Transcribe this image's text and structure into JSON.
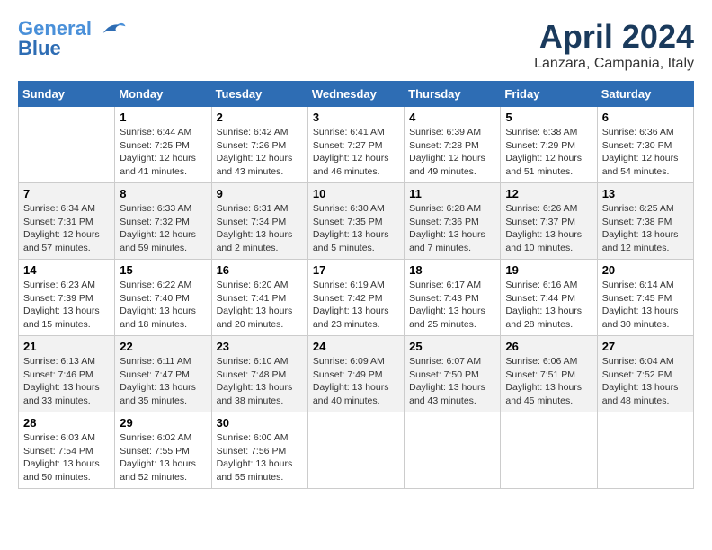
{
  "header": {
    "logo_line1": "General",
    "logo_line2": "Blue",
    "month": "April 2024",
    "location": "Lanzara, Campania, Italy"
  },
  "weekdays": [
    "Sunday",
    "Monday",
    "Tuesday",
    "Wednesday",
    "Thursday",
    "Friday",
    "Saturday"
  ],
  "weeks": [
    [
      {
        "day": "",
        "sunrise": "",
        "sunset": "",
        "daylight": ""
      },
      {
        "day": "1",
        "sunrise": "Sunrise: 6:44 AM",
        "sunset": "Sunset: 7:25 PM",
        "daylight": "Daylight: 12 hours and 41 minutes."
      },
      {
        "day": "2",
        "sunrise": "Sunrise: 6:42 AM",
        "sunset": "Sunset: 7:26 PM",
        "daylight": "Daylight: 12 hours and 43 minutes."
      },
      {
        "day": "3",
        "sunrise": "Sunrise: 6:41 AM",
        "sunset": "Sunset: 7:27 PM",
        "daylight": "Daylight: 12 hours and 46 minutes."
      },
      {
        "day": "4",
        "sunrise": "Sunrise: 6:39 AM",
        "sunset": "Sunset: 7:28 PM",
        "daylight": "Daylight: 12 hours and 49 minutes."
      },
      {
        "day": "5",
        "sunrise": "Sunrise: 6:38 AM",
        "sunset": "Sunset: 7:29 PM",
        "daylight": "Daylight: 12 hours and 51 minutes."
      },
      {
        "day": "6",
        "sunrise": "Sunrise: 6:36 AM",
        "sunset": "Sunset: 7:30 PM",
        "daylight": "Daylight: 12 hours and 54 minutes."
      }
    ],
    [
      {
        "day": "7",
        "sunrise": "Sunrise: 6:34 AM",
        "sunset": "Sunset: 7:31 PM",
        "daylight": "Daylight: 12 hours and 57 minutes."
      },
      {
        "day": "8",
        "sunrise": "Sunrise: 6:33 AM",
        "sunset": "Sunset: 7:32 PM",
        "daylight": "Daylight: 12 hours and 59 minutes."
      },
      {
        "day": "9",
        "sunrise": "Sunrise: 6:31 AM",
        "sunset": "Sunset: 7:34 PM",
        "daylight": "Daylight: 13 hours and 2 minutes."
      },
      {
        "day": "10",
        "sunrise": "Sunrise: 6:30 AM",
        "sunset": "Sunset: 7:35 PM",
        "daylight": "Daylight: 13 hours and 5 minutes."
      },
      {
        "day": "11",
        "sunrise": "Sunrise: 6:28 AM",
        "sunset": "Sunset: 7:36 PM",
        "daylight": "Daylight: 13 hours and 7 minutes."
      },
      {
        "day": "12",
        "sunrise": "Sunrise: 6:26 AM",
        "sunset": "Sunset: 7:37 PM",
        "daylight": "Daylight: 13 hours and 10 minutes."
      },
      {
        "day": "13",
        "sunrise": "Sunrise: 6:25 AM",
        "sunset": "Sunset: 7:38 PM",
        "daylight": "Daylight: 13 hours and 12 minutes."
      }
    ],
    [
      {
        "day": "14",
        "sunrise": "Sunrise: 6:23 AM",
        "sunset": "Sunset: 7:39 PM",
        "daylight": "Daylight: 13 hours and 15 minutes."
      },
      {
        "day": "15",
        "sunrise": "Sunrise: 6:22 AM",
        "sunset": "Sunset: 7:40 PM",
        "daylight": "Daylight: 13 hours and 18 minutes."
      },
      {
        "day": "16",
        "sunrise": "Sunrise: 6:20 AM",
        "sunset": "Sunset: 7:41 PM",
        "daylight": "Daylight: 13 hours and 20 minutes."
      },
      {
        "day": "17",
        "sunrise": "Sunrise: 6:19 AM",
        "sunset": "Sunset: 7:42 PM",
        "daylight": "Daylight: 13 hours and 23 minutes."
      },
      {
        "day": "18",
        "sunrise": "Sunrise: 6:17 AM",
        "sunset": "Sunset: 7:43 PM",
        "daylight": "Daylight: 13 hours and 25 minutes."
      },
      {
        "day": "19",
        "sunrise": "Sunrise: 6:16 AM",
        "sunset": "Sunset: 7:44 PM",
        "daylight": "Daylight: 13 hours and 28 minutes."
      },
      {
        "day": "20",
        "sunrise": "Sunrise: 6:14 AM",
        "sunset": "Sunset: 7:45 PM",
        "daylight": "Daylight: 13 hours and 30 minutes."
      }
    ],
    [
      {
        "day": "21",
        "sunrise": "Sunrise: 6:13 AM",
        "sunset": "Sunset: 7:46 PM",
        "daylight": "Daylight: 13 hours and 33 minutes."
      },
      {
        "day": "22",
        "sunrise": "Sunrise: 6:11 AM",
        "sunset": "Sunset: 7:47 PM",
        "daylight": "Daylight: 13 hours and 35 minutes."
      },
      {
        "day": "23",
        "sunrise": "Sunrise: 6:10 AM",
        "sunset": "Sunset: 7:48 PM",
        "daylight": "Daylight: 13 hours and 38 minutes."
      },
      {
        "day": "24",
        "sunrise": "Sunrise: 6:09 AM",
        "sunset": "Sunset: 7:49 PM",
        "daylight": "Daylight: 13 hours and 40 minutes."
      },
      {
        "day": "25",
        "sunrise": "Sunrise: 6:07 AM",
        "sunset": "Sunset: 7:50 PM",
        "daylight": "Daylight: 13 hours and 43 minutes."
      },
      {
        "day": "26",
        "sunrise": "Sunrise: 6:06 AM",
        "sunset": "Sunset: 7:51 PM",
        "daylight": "Daylight: 13 hours and 45 minutes."
      },
      {
        "day": "27",
        "sunrise": "Sunrise: 6:04 AM",
        "sunset": "Sunset: 7:52 PM",
        "daylight": "Daylight: 13 hours and 48 minutes."
      }
    ],
    [
      {
        "day": "28",
        "sunrise": "Sunrise: 6:03 AM",
        "sunset": "Sunset: 7:54 PM",
        "daylight": "Daylight: 13 hours and 50 minutes."
      },
      {
        "day": "29",
        "sunrise": "Sunrise: 6:02 AM",
        "sunset": "Sunset: 7:55 PM",
        "daylight": "Daylight: 13 hours and 52 minutes."
      },
      {
        "day": "30",
        "sunrise": "Sunrise: 6:00 AM",
        "sunset": "Sunset: 7:56 PM",
        "daylight": "Daylight: 13 hours and 55 minutes."
      },
      {
        "day": "",
        "sunrise": "",
        "sunset": "",
        "daylight": ""
      },
      {
        "day": "",
        "sunrise": "",
        "sunset": "",
        "daylight": ""
      },
      {
        "day": "",
        "sunrise": "",
        "sunset": "",
        "daylight": ""
      },
      {
        "day": "",
        "sunrise": "",
        "sunset": "",
        "daylight": ""
      }
    ]
  ]
}
